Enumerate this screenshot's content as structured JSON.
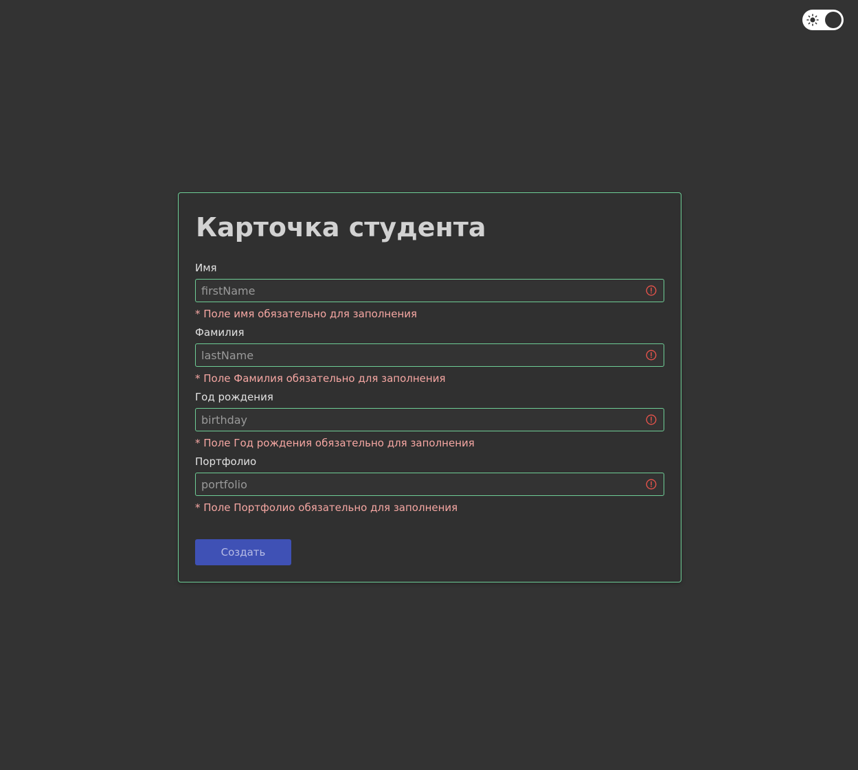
{
  "header": {
    "theme_toggle": {
      "icon": "sun-icon",
      "state": "dark"
    }
  },
  "form": {
    "title": "Карточка студента",
    "fields": [
      {
        "label": "Имя",
        "placeholder": "firstName",
        "value": "",
        "error": "* Поле имя обязательно для заполнения"
      },
      {
        "label": "Фамилия",
        "placeholder": "lastName",
        "value": "",
        "error": "* Поле Фамилия обязательно для заполнения"
      },
      {
        "label": "Год рождения",
        "placeholder": "birthday",
        "value": "",
        "error": "* Поле Год рождения обязательно для заполнения"
      },
      {
        "label": "Портфолио",
        "placeholder": "portfolio",
        "value": "",
        "error": "* Поле Портфолио обязательно для заполнения"
      }
    ],
    "submit_label": "Создать"
  },
  "colors": {
    "background": "#333333",
    "card_border": "#6fcf97",
    "error": "#f6a7a3",
    "error_icon": "#e5534b",
    "primary_button": "#3f51b5"
  }
}
